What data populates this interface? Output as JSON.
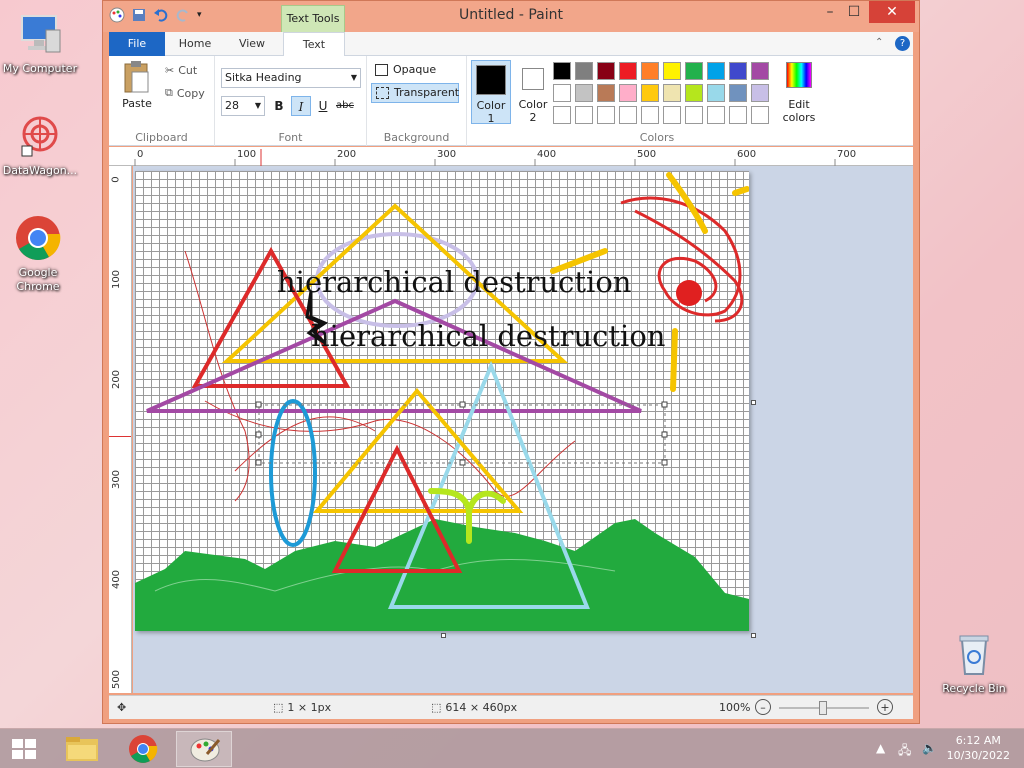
{
  "desktop": {
    "icons": [
      {
        "label": "My Computer"
      },
      {
        "label": "DataWagon..."
      },
      {
        "label": "Google Chrome"
      },
      {
        "label": "Recycle Bin"
      }
    ]
  },
  "window": {
    "title": "Untitled - Paint",
    "context_tab_header": "Text Tools",
    "controls": {
      "minimize": "–",
      "maximize": "☐",
      "close": "✕"
    }
  },
  "ribbon_tabs": [
    "File",
    "Home",
    "View",
    "Text"
  ],
  "ribbon": {
    "clipboard": {
      "paste": "Paste",
      "cut": "Cut",
      "copy": "Copy",
      "label": "Clipboard"
    },
    "font": {
      "family": "Sitka Heading",
      "size": "28",
      "bold": "B",
      "italic": "I",
      "underline": "U",
      "strike": "abc",
      "label": "Font"
    },
    "background": {
      "opaque": "Opaque",
      "transparent": "Transparent",
      "label": "Background"
    },
    "colors": {
      "color1_label": "Color",
      "color1_num": "1",
      "color2_label": "Color",
      "color2_num": "2",
      "color1": "#000000",
      "color2": "#ffffff",
      "edit_line1": "Edit",
      "edit_line2": "colors",
      "label": "Colors",
      "palette": [
        "#000000",
        "#7f7f7f",
        "#880015",
        "#ed1c24",
        "#ff7f27",
        "#fff200",
        "#22b14c",
        "#00a2e8",
        "#3f48cc",
        "#a349a4",
        "#ffffff",
        "#c3c3c3",
        "#b97a57",
        "#ffaec9",
        "#ffc90e",
        "#efe4b0",
        "#b5e61d",
        "#99d9ea",
        "#7092be",
        "#c8bfe7",
        "#ffffff",
        "#ffffff",
        "#ffffff",
        "#ffffff",
        "#ffffff",
        "#ffffff",
        "#ffffff",
        "#ffffff",
        "#ffffff",
        "#ffffff"
      ]
    }
  },
  "rulers": {
    "h": [
      "0",
      "100",
      "200",
      "300",
      "400",
      "500",
      "600",
      "700"
    ],
    "v": [
      "0",
      "100",
      "200",
      "300",
      "400",
      "500"
    ]
  },
  "canvas": {
    "text1": "hierarchical destruction",
    "text2": "hierarchical destruction"
  },
  "status": {
    "cursor": "1 × 1px",
    "size": "614 × 460px",
    "zoom": "100%"
  },
  "taskbar": {
    "time": "6:12 AM",
    "date": "10/30/2022"
  }
}
